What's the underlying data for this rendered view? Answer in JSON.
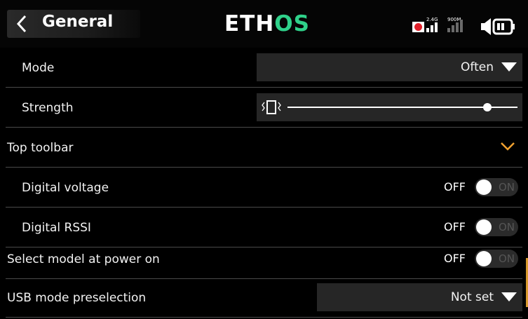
{
  "header": {
    "title": "General",
    "logo_part1": "ETH",
    "logo_part2": "OS",
    "status_labels": {
      "band_24": "2.4G",
      "band_900": "900M"
    }
  },
  "rows": {
    "mode": {
      "label": "Mode",
      "value": "Often"
    },
    "strength": {
      "label": "Strength",
      "level": 0.87
    },
    "top_toolbar": {
      "label": "Top toolbar",
      "expanded": true
    },
    "digital_voltage": {
      "label": "Digital voltage",
      "off": "OFF",
      "on": "ON",
      "state": false
    },
    "digital_rssi": {
      "label": "Digital RSSI",
      "off": "OFF",
      "on": "ON",
      "state": false
    },
    "select_model": {
      "label": "Select model at power on",
      "off": "OFF",
      "on": "ON",
      "state": false
    },
    "usb_mode": {
      "label": "USB mode preselection",
      "value": "Not set"
    }
  },
  "icons": {
    "back": "chevron-left-icon",
    "vibration": "vibrate-icon",
    "expand": "chevron-down-icon",
    "dropdown": "caret-down-icon",
    "record": "record-icon",
    "signal": "signal-bars-icon",
    "volume": "speaker-icon",
    "battery": "battery-icon"
  },
  "colors": {
    "accent_green": "#2fd18a",
    "accent_orange": "#f0a030",
    "record_red": "#e0202a",
    "panel": "#262626",
    "background": "#000000"
  }
}
